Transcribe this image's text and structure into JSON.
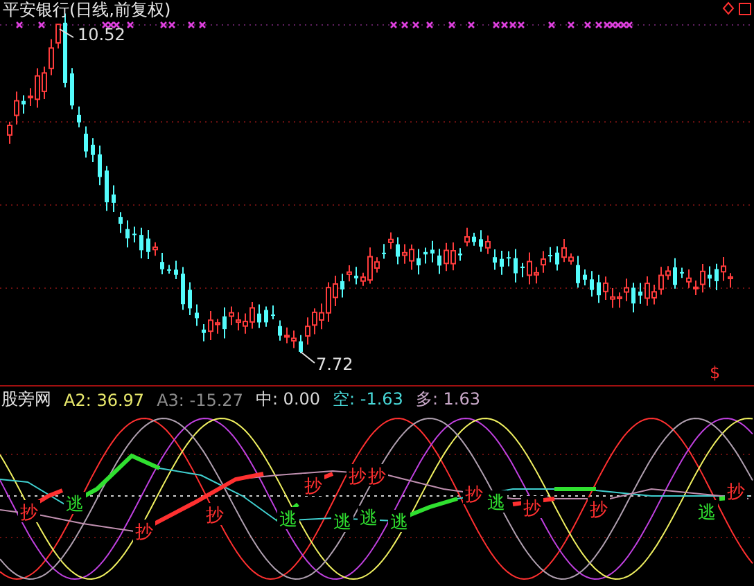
{
  "main_chart": {
    "title": "平安银行(日线,前复权)",
    "high_label": "10.52",
    "low_label": "7.72",
    "signal_mark": "$"
  },
  "indicator": {
    "name": "股旁网",
    "values": [
      {
        "text": "A2: 36.97",
        "color": "#e8e86c"
      },
      {
        "text": "A3: -15.27",
        "color": "#8c8c8c"
      },
      {
        "text": "中: 0.00",
        "color": "#d8d8d8"
      },
      {
        "text": "空: -1.63",
        "color": "#48d8d8"
      },
      {
        "text": "多: 1.63",
        "color": "#c8a8c8"
      }
    ]
  },
  "signals": [
    {
      "kind": "buy",
      "text": "抄"
    },
    {
      "kind": "sell",
      "text": "逃"
    },
    {
      "kind": "buy",
      "text": "抄"
    },
    {
      "kind": "buy",
      "text": "抄"
    },
    {
      "kind": "sell",
      "text": "逃"
    },
    {
      "kind": "buy",
      "text": "抄"
    },
    {
      "kind": "sell",
      "text": "逃"
    },
    {
      "kind": "buy",
      "text": "抄"
    },
    {
      "kind": "sell",
      "text": "逃"
    },
    {
      "kind": "buy",
      "text": "抄"
    },
    {
      "kind": "sell",
      "text": "逃"
    },
    {
      "kind": "buy",
      "text": "抄"
    },
    {
      "kind": "sell",
      "text": "逃"
    },
    {
      "kind": "buy",
      "text": "抄"
    },
    {
      "kind": "buy",
      "text": "抄"
    },
    {
      "kind": "sell",
      "text": "逃"
    },
    {
      "kind": "buy",
      "text": "抄"
    }
  ]
}
